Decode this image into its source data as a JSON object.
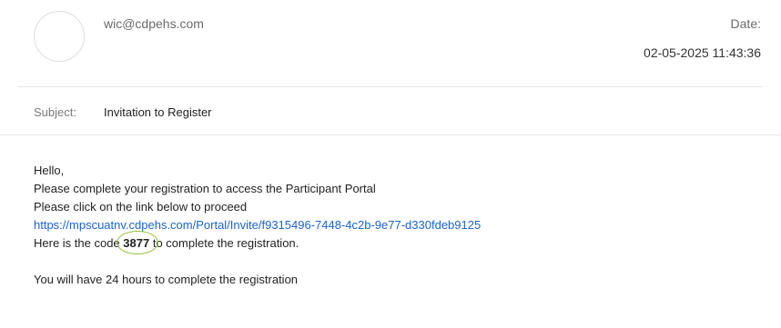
{
  "email": {
    "sender": "wic@cdpehs.com",
    "date_label": "Date:",
    "date_value": "02-05-2025 11:43:36",
    "subject_label": "Subject:",
    "subject_value": "Invitation to Register",
    "body": {
      "greeting": "Hello,",
      "line1": "Please complete your registration to access the Participant Portal",
      "line2": "Please click on the link below to proceed",
      "link": "https://mpscuatnv.cdpehs.com/Portal/Invite/f9315496-7448-4c2b-9e77-d330fdeb9125",
      "code_prefix": "Here is the code",
      "code": "3877",
      "code_suffix": "to complete the registration.",
      "closing": "You will have 24 hours to complete the registration"
    }
  },
  "colors": {
    "link": "#1a64c8",
    "highlight_circle": "#8fbf3a"
  }
}
